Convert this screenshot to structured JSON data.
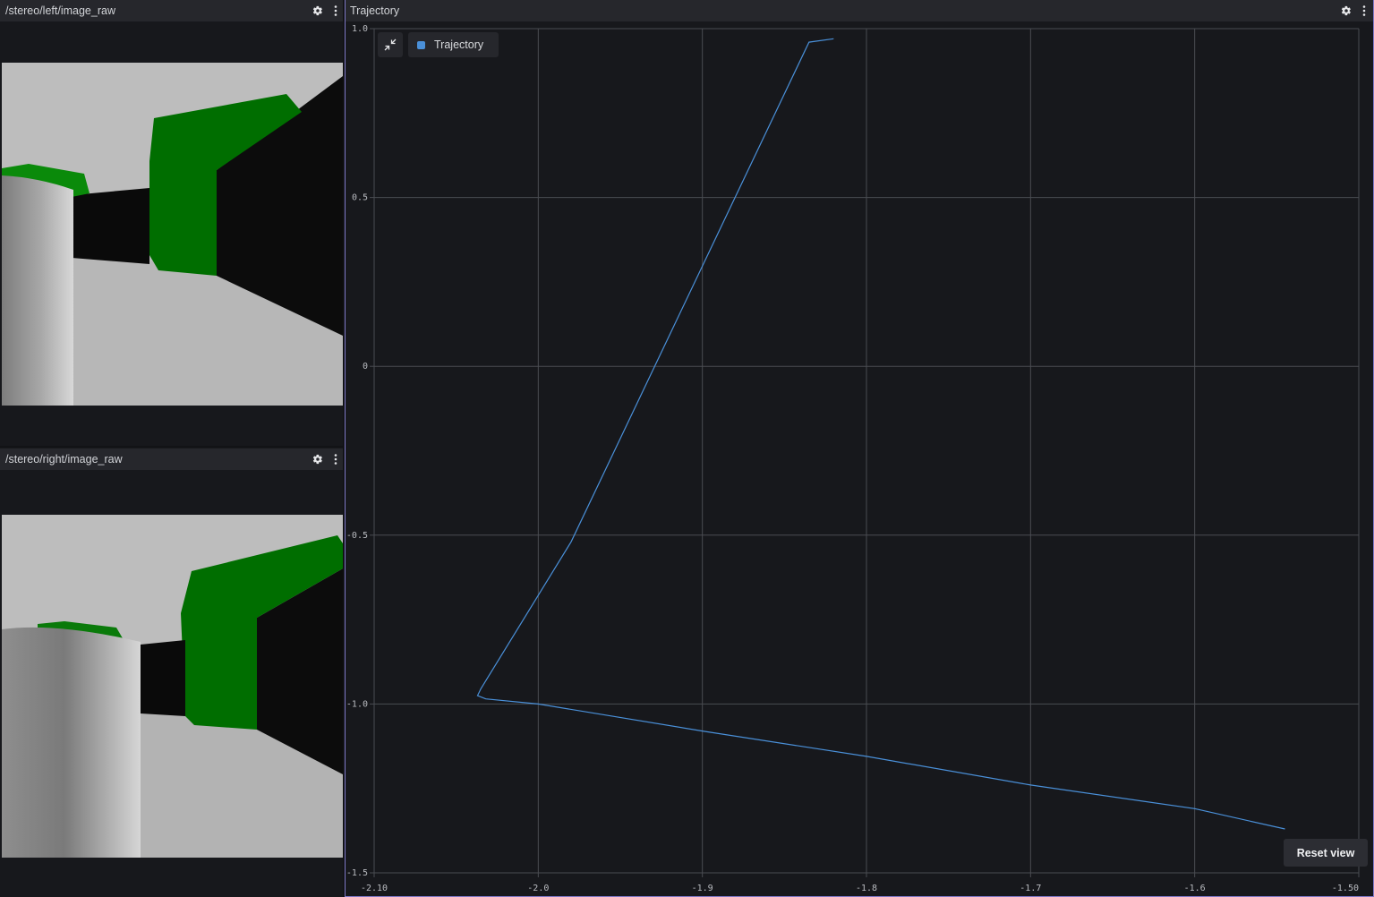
{
  "left_top_panel": {
    "title": "/stereo/left/image_raw",
    "settings_icon": "gear-icon",
    "menu_icon": "more-vertical-icon"
  },
  "left_bottom_panel": {
    "title": "/stereo/right/image_raw",
    "settings_icon": "gear-icon",
    "menu_icon": "more-vertical-icon"
  },
  "plot_panel": {
    "title": "Trajectory",
    "settings_icon": "gear-icon",
    "menu_icon": "more-vertical-icon",
    "legend_label": "Trajectory",
    "collapse_icon": "collapse-arrows-icon",
    "reset_label": "Reset view"
  },
  "colors": {
    "accent": "#4a90d9",
    "background": "#17181c",
    "header": "#26272c",
    "grid": "#4a4c52",
    "selected_border": "#7e78c7"
  },
  "chart_data": {
    "type": "line",
    "title": "",
    "xlabel": "",
    "ylabel": "",
    "xlim": [
      -2.1,
      -1.5
    ],
    "ylim": [
      -1.5,
      1.0
    ],
    "x_ticks": [
      -2.1,
      -2.0,
      -1.9,
      -1.8,
      -1.7,
      -1.6,
      -1.5
    ],
    "x_tick_labels": [
      "-2.10",
      "-2.0",
      "-1.9",
      "-1.8",
      "-1.7",
      "-1.6",
      "-1.50"
    ],
    "y_ticks": [
      1.0,
      0.5,
      0,
      -0.5,
      -1.0,
      -1.5
    ],
    "y_tick_labels": [
      "1.0",
      "0.5",
      "0",
      "-0.5",
      "-1.0",
      "-1.5"
    ],
    "grid": true,
    "legend": "top-left",
    "series": [
      {
        "name": "Trajectory",
        "color": "#4a90d9",
        "x": [
          -1.82,
          -1.835,
          -1.98,
          -2.035,
          -2.037,
          -2.032,
          -2.0,
          -1.9,
          -1.8,
          -1.7,
          -1.6,
          -1.545
        ],
        "y": [
          0.97,
          0.96,
          -0.52,
          -0.955,
          -0.975,
          -0.985,
          -1.0,
          -1.08,
          -1.155,
          -1.24,
          -1.31,
          -1.37
        ]
      }
    ]
  }
}
